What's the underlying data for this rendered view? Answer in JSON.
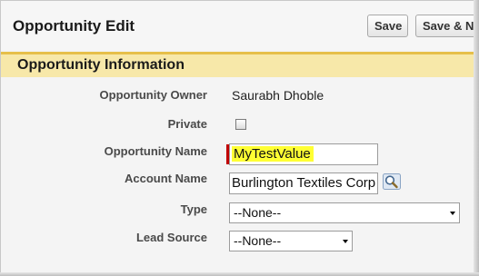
{
  "header": {
    "title": "Opportunity Edit",
    "save_label": "Save",
    "save_new_label": "Save & New"
  },
  "section": {
    "title": "Opportunity Information"
  },
  "fields": {
    "owner": {
      "label": "Opportunity Owner",
      "value": "Saurabh Dhoble"
    },
    "private": {
      "label": "Private",
      "checked": false
    },
    "opportunity_name": {
      "label": "Opportunity Name",
      "value": "MyTestValue"
    },
    "account_name": {
      "label": "Account Name",
      "value": "Burlington Textiles Corp"
    },
    "type": {
      "label": "Type",
      "selected": "--None--"
    },
    "lead_source": {
      "label": "Lead Source",
      "selected": "--None--"
    }
  },
  "icons": {
    "lookup": "magnifier-lookup-icon",
    "required": "required-indicator"
  },
  "colors": {
    "section_header_bg": "#f7e8a9",
    "section_header_border": "#e6bf4a",
    "required": "#c00000",
    "highlight": "#ffff33"
  }
}
